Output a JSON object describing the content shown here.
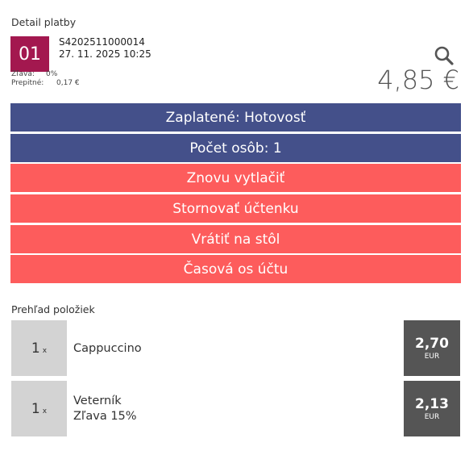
{
  "header": {
    "title": "Detail platby",
    "order_number": "01",
    "receipt_id": "S4202511000014",
    "receipt_datetime": "27. 11. 2025 10:25",
    "discount_label": "Zľava:",
    "discount_value": "0%",
    "tip_label": "Prepitné:",
    "tip_value": "0,17 €",
    "total": "4,85 €",
    "search_icon": "search-icon"
  },
  "actions": {
    "paid": "Zaplatené: Hotovosť",
    "guests": "Počet osôb: 1",
    "reprint": "Znovu vytlačiť",
    "cancel": "Stornovať účtenku",
    "return_to_table": "Vrátiť na stôl",
    "timeline": "Časová os účtu"
  },
  "colors": {
    "accent": "#a3184f",
    "info_button": "#44508a",
    "action_button": "#fd5c5c",
    "price_box": "#555555",
    "qty_box": "#d3d3d3"
  },
  "items_section": {
    "title": "Prehľad položiek",
    "items": [
      {
        "qty": "1",
        "qty_suffix": "x",
        "name": "Cappuccino",
        "note": "",
        "price": "2,70",
        "currency": "EUR"
      },
      {
        "qty": "1",
        "qty_suffix": "x",
        "name": "Veterník",
        "note": "Zľava 15%",
        "price": "2,13",
        "currency": "EUR"
      }
    ]
  }
}
